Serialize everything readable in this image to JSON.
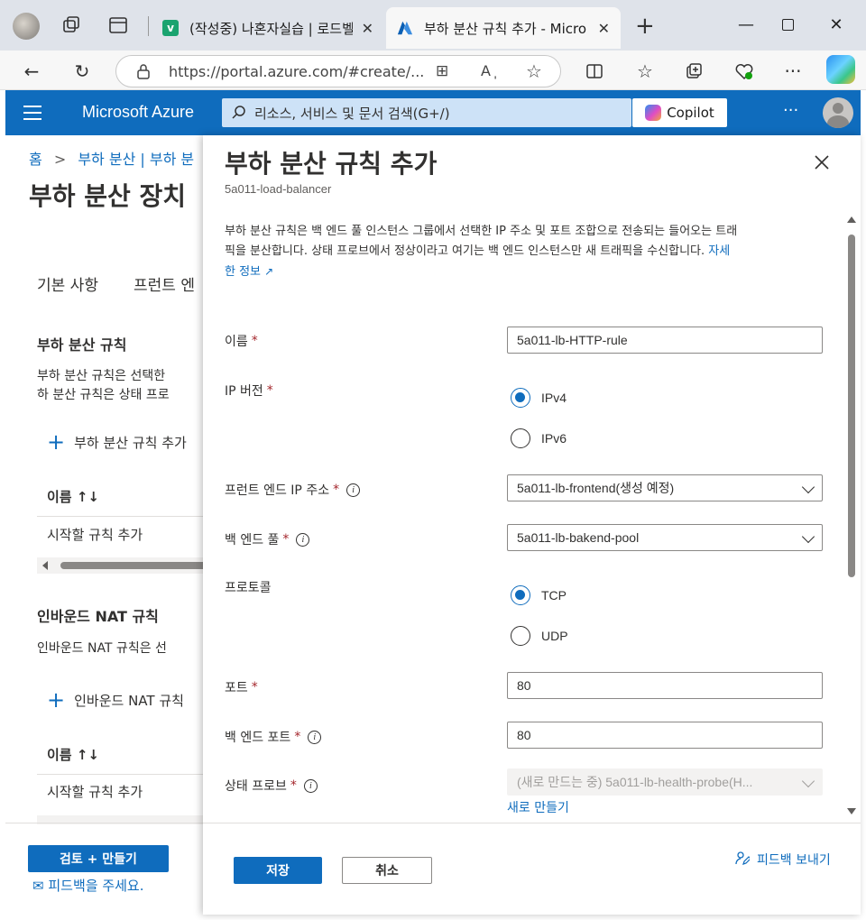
{
  "browser": {
    "tabs": [
      {
        "title": "(작성중) 나혼자실습 | 로드벨",
        "favicon_color": "#1aa36f",
        "favicon_letter": "v"
      },
      {
        "title": "부하 분산 규칙 추가 - Micro",
        "favicon_color": "#0f6cbd",
        "favicon_letter": "A"
      }
    ],
    "url": "https://portal.azure.com/#create/..."
  },
  "azure": {
    "brand": "Microsoft Azure",
    "search_placeholder": "리소스, 서비스 및 문서 검색(G+/)",
    "copilot_label": "Copilot",
    "more": "···"
  },
  "background_page": {
    "breadcrumb": {
      "home": "홈",
      "sep": ">",
      "item": "부하 분산 | 부하 분"
    },
    "title": "부하 분산 장치",
    "tabs": [
      "기본 사항",
      "프런트 엔"
    ],
    "sections": [
      {
        "heading": "부하 분산 규칙",
        "desc_line1": "부하 분산 규칙은 선택한",
        "desc_line2": "하 분산 규칙은 상태 프로",
        "add_label": "부하 분산 규칙 추가",
        "col_header": "이름 ↑↓",
        "row": "시작할 규칙 추가"
      },
      {
        "heading": "인바운드 NAT 규칙",
        "desc_line1": "인바운드 NAT 규칙은 선",
        "add_label": "인바운드 NAT 규칙",
        "col_header": "이름 ↑↓",
        "row": "시작할 규칙 추가"
      }
    ],
    "review_button": "검토 + 만들기",
    "feedback": "피드백을 주세요."
  },
  "panel": {
    "title": "부하 분산 규칙 추가",
    "subtitle": "5a011-load-balancer",
    "description_line1": "부하 분산 규칙은 백 엔드 풀 인스턴스 그룹에서 선택한 IP 주소 및 포트 조합으로 전송되는 들어오는 트래",
    "description_line2": "픽을 분산합니다. 상태 프로브에서 정상이라고 여기는 백 엔드 인스턴스만 새 트래픽을 수신합니다.",
    "learn_more_a": "자세",
    "learn_more_b": "한 정보",
    "fields": {
      "name": {
        "label": "이름",
        "value": "5a011-lb-HTTP-rule"
      },
      "ip_version": {
        "label": "IP 버전",
        "options": [
          "IPv4",
          "IPv6"
        ],
        "selected": "IPv4"
      },
      "frontend_ip": {
        "label": "프런트 엔드 IP 주소",
        "value": "5a011-lb-frontend(생성 예정)"
      },
      "backend_pool": {
        "label": "백 엔드 풀",
        "value": "5a011-lb-bakend-pool"
      },
      "protocol": {
        "label": "프로토콜",
        "options": [
          "TCP",
          "UDP"
        ],
        "selected": "TCP"
      },
      "port": {
        "label": "포트",
        "value": "80"
      },
      "backend_port": {
        "label": "백 엔드 포트",
        "value": "80"
      },
      "health_probe": {
        "label": "상태 프로브",
        "value": "(새로 만드는 중) 5a011-lb-health-probe(H...",
        "create_new": "새로 만들기"
      }
    },
    "required_mark": "*",
    "footer": {
      "save": "저장",
      "cancel": "취소",
      "feedback": "피드백 보내기"
    }
  },
  "colors": {
    "azure_blue": "#0f6cbd",
    "search_bg": "#cde2f7",
    "required": "#a4262c"
  }
}
